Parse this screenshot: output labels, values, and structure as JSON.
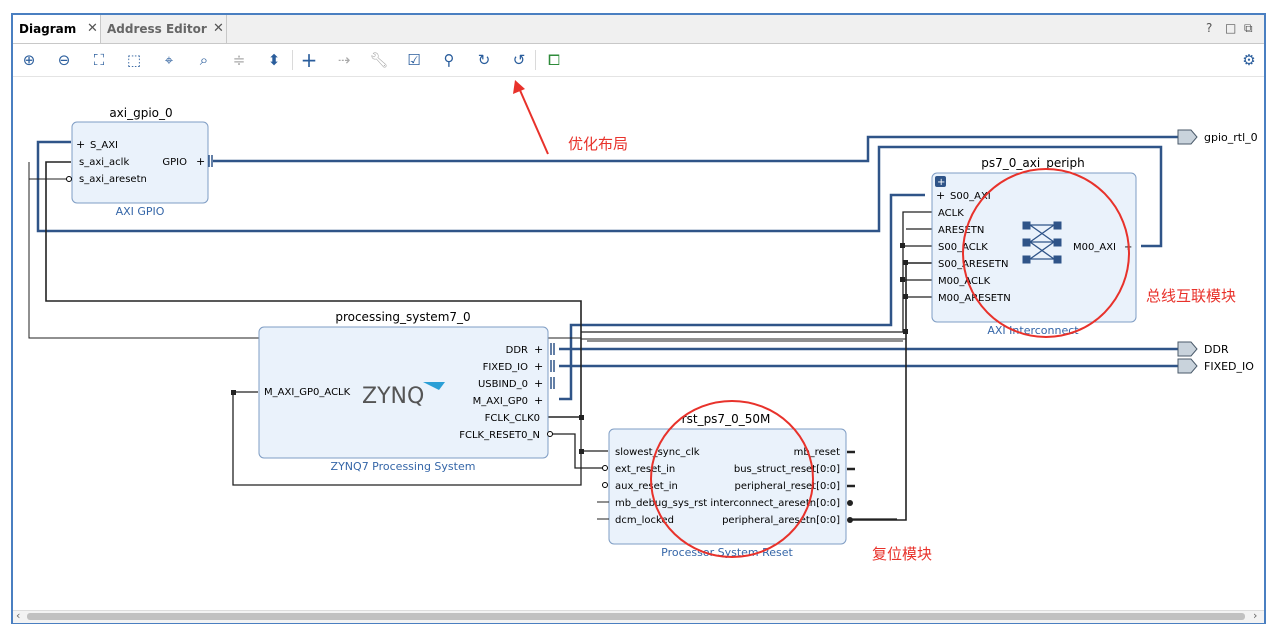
{
  "tabs": [
    {
      "label": "Diagram",
      "active": true
    },
    {
      "label": "Address Editor",
      "active": false
    }
  ],
  "window_buttons": {
    "help": "?",
    "maximize": "□",
    "restore": "⧉"
  },
  "toolbar": {
    "icons": [
      "zoom-in-icon",
      "zoom-out-icon",
      "fit-icon",
      "zoom-select-icon",
      "center-icon",
      "search-icon",
      "collapse-icon",
      "expand-icon",
      "add-ip-icon",
      "make-connection-icon",
      "settings-wrench-icon",
      "validate-icon",
      "pin-icon",
      "refresh-icon",
      "regenerate-layout-icon",
      "auto-connect-icon"
    ],
    "settings_icon": "gear-icon"
  },
  "blocks": {
    "axi_gpio": {
      "instance": "axi_gpio_0",
      "title": "AXI GPIO",
      "ports_left": [
        "S_AXI",
        "s_axi_aclk",
        "s_axi_aresetn"
      ],
      "ports_right": [
        "GPIO"
      ]
    },
    "interconnect": {
      "instance": "ps7_0_axi_periph",
      "title": "AXI Interconnect",
      "ports_left": [
        "S00_AXI",
        "ACLK",
        "ARESETN",
        "S00_ACLK",
        "S00_ARESETN",
        "M00_ACLK",
        "M00_ARESETN"
      ],
      "ports_right": [
        "M00_AXI"
      ]
    },
    "ps7": {
      "instance": "processing_system7_0",
      "title": "ZYNQ7 Processing System",
      "logo": "ZYNQ",
      "ports_left": [
        "M_AXI_GP0_ACLK"
      ],
      "ports_right": [
        "DDR",
        "FIXED_IO",
        "USBIND_0",
        "M_AXI_GP0",
        "FCLK_CLK0",
        "FCLK_RESET0_N"
      ]
    },
    "rst": {
      "instance": "rst_ps7_0_50M",
      "title": "Processor System Reset",
      "ports_left": [
        "slowest_sync_clk",
        "ext_reset_in",
        "aux_reset_in",
        "mb_debug_sys_rst",
        "dcm_locked"
      ],
      "ports_right": [
        "mb_reset",
        "bus_struct_reset[0:0]",
        "peripheral_reset[0:0]",
        "interconnect_aresetn[0:0]",
        "peripheral_aresetn[0:0]"
      ]
    }
  },
  "external_ports": [
    "gpio_rtl_0",
    "DDR",
    "FIXED_IO"
  ],
  "annotations": {
    "layout_note": "优化布局",
    "interconnect_note": "总线互联模块",
    "reset_note": "复位模块"
  },
  "colors": {
    "block_fill": "#eaf2fb",
    "block_border": "#7f9dc4",
    "bus_wire": "#2f5488",
    "net_wire": "#222222",
    "annotation": "#e8322b",
    "title_blue": "#3566a8"
  }
}
